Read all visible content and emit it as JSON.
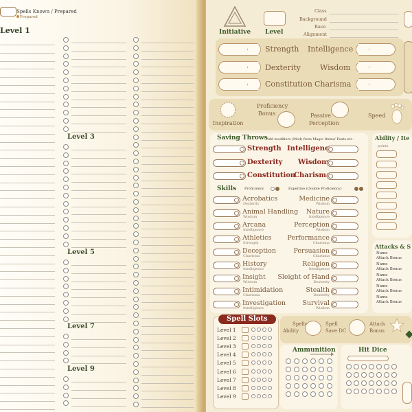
{
  "spells": {
    "header_title": "Spells Known / Prepared",
    "header_sub": "Prepared",
    "levels": [
      "Level 1",
      "Level 3",
      "Level 5",
      "Level 7",
      "Level 9"
    ]
  },
  "top": {
    "initiative": "Initiative",
    "level": "Level",
    "class": "Class",
    "background": "Background",
    "race": "Race",
    "alignment": "Alignment"
  },
  "abilities": {
    "left": [
      "Strength",
      "Dexterity",
      "Constitution"
    ],
    "right": [
      "Intelligence",
      "Wisdom",
      "Charisma"
    ]
  },
  "mid": {
    "proficiency": "Proficiency",
    "bonus": "Bonus",
    "passive": "Passive",
    "perception": "Perception",
    "inspiration": "Inspiration",
    "speed": "Speed"
  },
  "saving": {
    "title": "Saving Throws",
    "note": "Add modifiers (Mod) from Magic Items/ Feats etc.",
    "left": [
      "Strength",
      "Dexterity",
      "Constitution"
    ],
    "right": [
      "Intelligence",
      "Wisdom",
      "Charisma"
    ]
  },
  "skills": {
    "title": "Skills",
    "prof": "Proficiency",
    "expertise": "Expertise (Double Proficiency)",
    "left": [
      {
        "name": "Acrobatics",
        "ab": "Dexterity"
      },
      {
        "name": "Animal Handling",
        "ab": "Wisdom"
      },
      {
        "name": "Arcana",
        "ab": "Intelligence"
      },
      {
        "name": "Athletics",
        "ab": "Strength"
      },
      {
        "name": "Deception",
        "ab": "Charisma"
      },
      {
        "name": "History",
        "ab": "Intelligence"
      },
      {
        "name": "Insight",
        "ab": "Wisdom"
      },
      {
        "name": "Intimidation",
        "ab": "Charisma"
      },
      {
        "name": "Investigation",
        "ab": "Intelligence"
      }
    ],
    "right": [
      {
        "name": "Medicine",
        "ab": "Wisdom"
      },
      {
        "name": "Nature",
        "ab": "Intelligence"
      },
      {
        "name": "Perception",
        "ab": "Wisdom"
      },
      {
        "name": "Performance",
        "ab": "Charisma"
      },
      {
        "name": "Persuasion",
        "ab": "Charisma"
      },
      {
        "name": "Religion",
        "ab": "Intelligence"
      },
      {
        "name": "Sleight of Hand",
        "ab": "Dexterity"
      },
      {
        "name": "Stealth",
        "ab": "Dexterity"
      },
      {
        "name": "Survival",
        "ab": "Wisdom"
      }
    ]
  },
  "ability_panel": {
    "title": "Ability / Ite",
    "points": "points"
  },
  "attacks": {
    "title": "Attacks & S",
    "name": "Name",
    "bonus": "Attack Bonus"
  },
  "spell_slots": {
    "title": "Spell Slots",
    "levels": [
      "Level 1",
      "Level 2",
      "Level 3",
      "Level 4",
      "Level 5",
      "Level 6",
      "Level 7",
      "Level 8",
      "Level 9"
    ]
  },
  "spellcast": {
    "ability": [
      "Spellcast",
      "Ability"
    ],
    "save": [
      "Spell",
      "Save DC"
    ],
    "attack": [
      "Attack",
      "Bonus"
    ]
  },
  "ammo": {
    "title": "Ammunition"
  },
  "hitdice": {
    "title": "Hit Dice"
  },
  "colors": {
    "accent": "#8a2a1e",
    "panel": "#ebdcb8",
    "frame": "#b8936a"
  }
}
